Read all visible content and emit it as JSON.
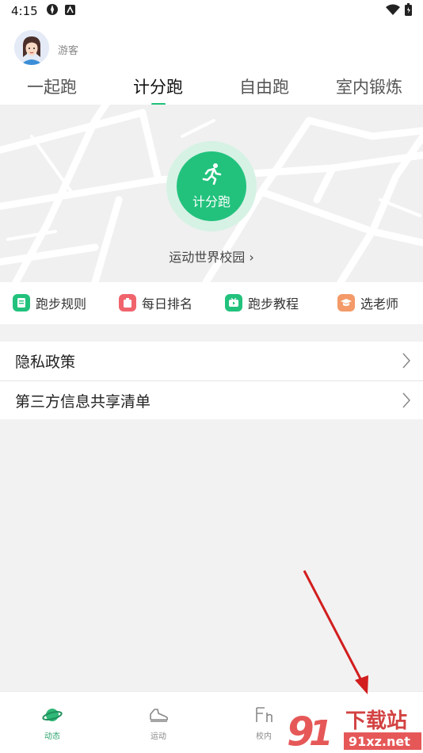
{
  "status_bar": {
    "time": "4:15"
  },
  "header": {
    "guest_label": "游客"
  },
  "tabs": [
    {
      "label": "一起跑"
    },
    {
      "label": "计分跑"
    },
    {
      "label": "自由跑"
    },
    {
      "label": "室内锻炼"
    }
  ],
  "map": {
    "run_button_label": "计分跑",
    "campus_label": "运动世界校园 ›"
  },
  "quick_actions": [
    {
      "label": "跑步规则",
      "color": "#22c27d"
    },
    {
      "label": "每日排名",
      "color": "#f0646c"
    },
    {
      "label": "跑步教程",
      "color": "#22c27d"
    },
    {
      "label": "选老师",
      "color": "#f39a68"
    }
  ],
  "list": [
    {
      "label": "隐私政策"
    },
    {
      "label": "第三方信息共享清单"
    }
  ],
  "bottom_nav": [
    {
      "label": "动态",
      "active": true
    },
    {
      "label": "运动"
    },
    {
      "label": "校内"
    }
  ],
  "watermark": {
    "text_top": "下载站",
    "text_bottom": "91xz.net"
  },
  "colors": {
    "accent": "#22c27d",
    "arrow": "#d21e1e"
  }
}
